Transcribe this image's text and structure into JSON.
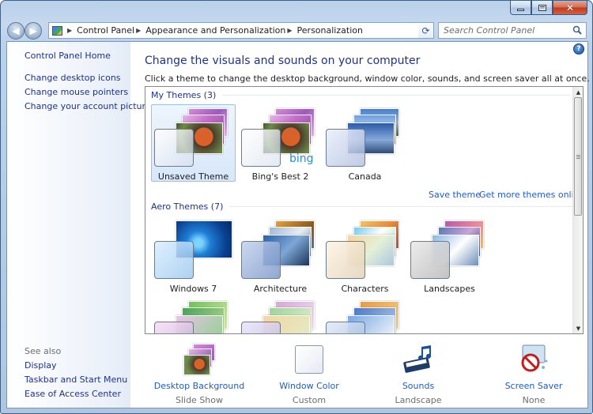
{
  "window": {
    "caption": {
      "minimize": "minimize-icon",
      "maximize": "maximize-icon",
      "close": "close-icon"
    }
  },
  "nav": {
    "crumbs": [
      "Control Panel",
      "Appearance and Personalization",
      "Personalization"
    ],
    "search_placeholder": "Search Control Panel"
  },
  "sidebar": {
    "home": "Control Panel Home",
    "tasks": [
      "Change desktop icons",
      "Change mouse pointers",
      "Change your account picture"
    ],
    "see_also_title": "See also",
    "see_also": [
      "Display",
      "Taskbar and Start Menu",
      "Ease of Access Center"
    ]
  },
  "main": {
    "heading": "Change the visuals and sounds on your computer",
    "instruction": "Click a theme to change the desktop background, window color, sounds, and screen saver all at once.",
    "my_themes_title": "My Themes (3)",
    "my_themes": [
      {
        "label": "Unsaved Theme",
        "selected": true
      },
      {
        "label": "Bing's Best 2",
        "selected": false,
        "badge": "bing"
      },
      {
        "label": "Canada",
        "selected": false
      }
    ],
    "save_theme": "Save theme",
    "get_more": "Get more themes online",
    "aero_title": "Aero Themes (7)",
    "aero_themes": [
      {
        "label": "Windows 7"
      },
      {
        "label": "Architecture"
      },
      {
        "label": "Characters"
      },
      {
        "label": "Landscapes"
      }
    ]
  },
  "bottom": [
    {
      "title": "Desktop Background",
      "value": "Slide Show",
      "icon": "desktop-background-icon"
    },
    {
      "title": "Window Color",
      "value": "Custom",
      "icon": "window-color-icon"
    },
    {
      "title": "Sounds",
      "value": "Landscape",
      "icon": "sounds-icon"
    },
    {
      "title": "Screen Saver",
      "value": "None",
      "icon": "screen-saver-icon"
    }
  ],
  "colors": {
    "link": "#1e5cc4",
    "heading": "#1e3287",
    "selected_bg": "#d7e7fa",
    "frame": "#b9d1ea"
  }
}
